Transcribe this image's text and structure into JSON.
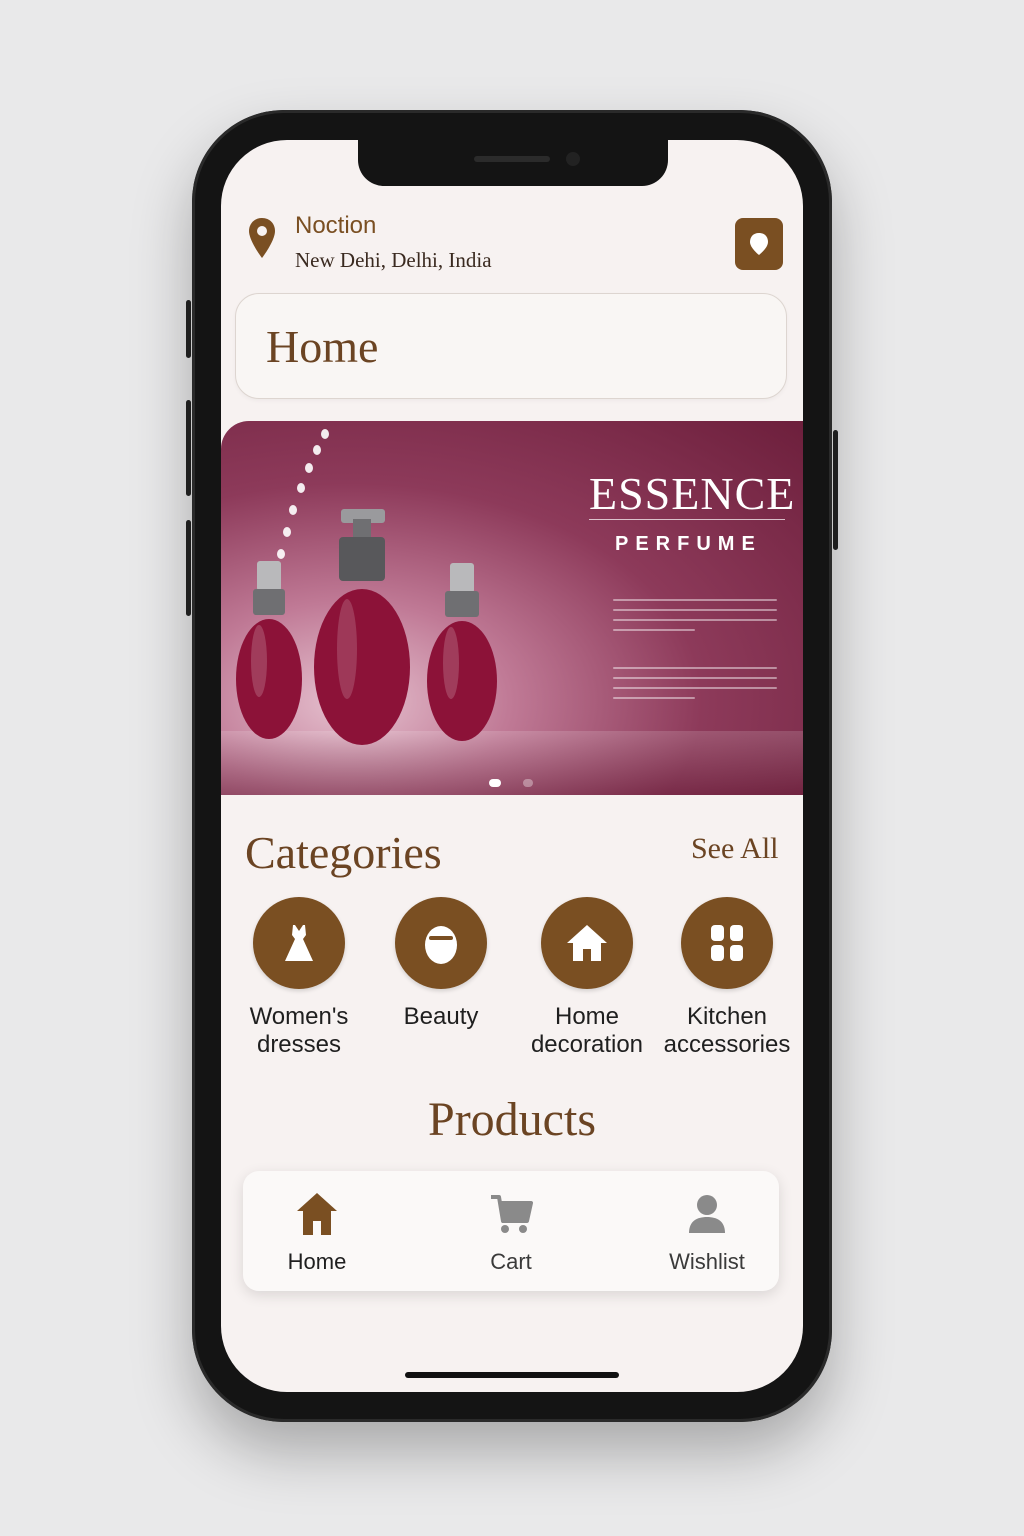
{
  "location": {
    "title": "Noction",
    "address": "New Dehi, Delhi, India",
    "pin_icon": "map-pin-icon",
    "button_icon": "location-shield-icon"
  },
  "search": {
    "value": "Home"
  },
  "banner": {
    "title": "ESSENCE",
    "subtitle": "PERFUME",
    "active_slide": 1,
    "slide_count": 2
  },
  "categories": {
    "title": "Categories",
    "see_all": "See All",
    "items": [
      {
        "label_line1": "Women's",
        "label_line2": "dresses",
        "icon": "dress-icon"
      },
      {
        "label_line1": "Beauty",
        "label_line2": "",
        "icon": "beauty-icon"
      },
      {
        "label_line1": "Home",
        "label_line2": "decoration",
        "icon": "house-icon"
      },
      {
        "label_line1": "Kitchen",
        "label_line2": "accessories",
        "icon": "grid-icon"
      }
    ]
  },
  "products": {
    "title": "Products"
  },
  "bottom_nav": {
    "items": [
      {
        "label": "Home",
        "icon": "home-icon",
        "active": true
      },
      {
        "label": "Cart",
        "icon": "cart-icon",
        "active": false
      },
      {
        "label": "Wishlist",
        "icon": "user-icon",
        "active": false
      }
    ]
  },
  "colors": {
    "accent": "#7a4f22",
    "background": "#f7f2f1",
    "banner": "#8d3a5a",
    "inactive": "#8a8a8a"
  }
}
